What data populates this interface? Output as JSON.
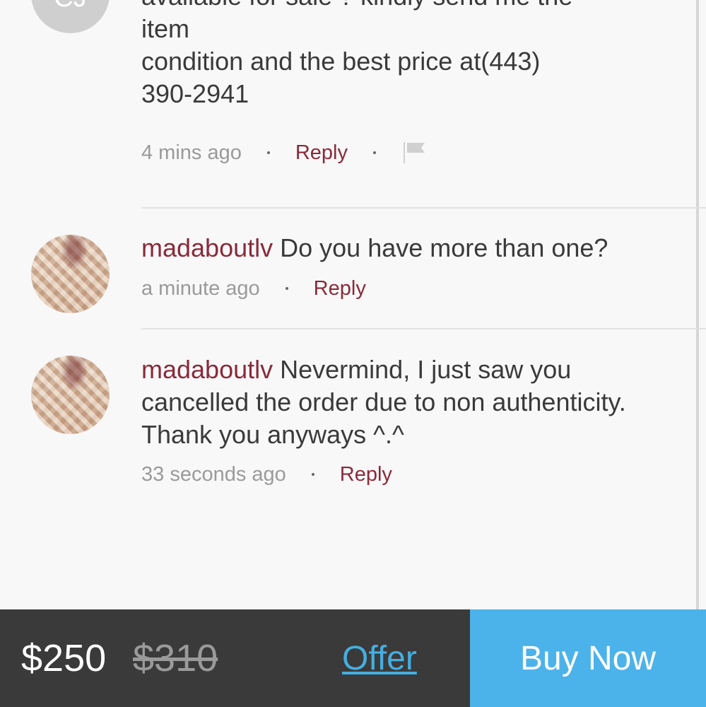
{
  "comments": [
    {
      "avatar_initials": "CJ",
      "lines": [
        "available for sale ? kindly send me the",
        "item",
        "condition and the best price at(443)",
        "390-2941"
      ],
      "time": "4 mins ago",
      "reply_label": "Reply",
      "flag_icon": "flag-icon"
    },
    {
      "username": "madaboutlv",
      "text": "Do you have more than one?",
      "time": "a minute ago",
      "reply_label": "Reply"
    },
    {
      "username": "madaboutlv",
      "text_line1": "Nevermind, I just saw you",
      "text_line2": "cancelled the order due to non authenticity.",
      "text_line3": "Thank you anyways ^.^",
      "time": "33 seconds ago",
      "reply_label": "Reply"
    }
  ],
  "bottom_bar": {
    "price": "$250",
    "original_price": "$310",
    "offer_label": "Offer",
    "buy_label": "Buy Now"
  },
  "colors": {
    "accent_username": "#8a2a3a",
    "offer_link": "#45aee0",
    "buy_button": "#4cb2ea",
    "bottom_bar_bg": "#3a3a3a"
  }
}
